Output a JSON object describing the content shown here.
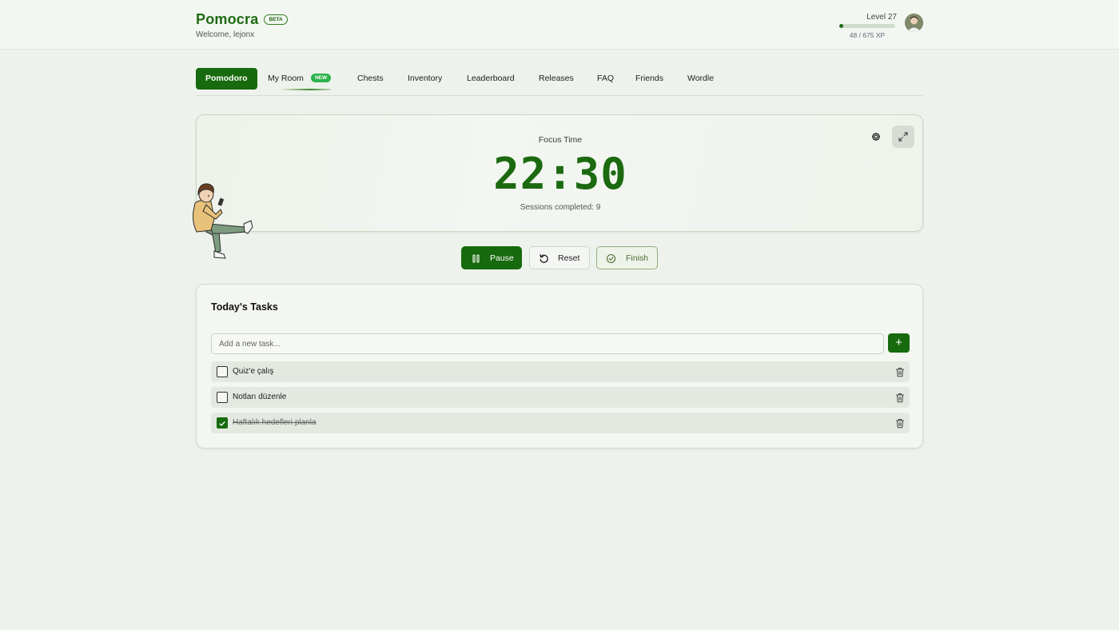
{
  "header": {
    "brand": "Pomocra",
    "beta_badge": "BETA",
    "welcome": "Welcome, lejonx",
    "level": "Level 27",
    "xp_text": "48 / 675 XP",
    "xp_progress": 0.071
  },
  "nav": {
    "tabs": [
      {
        "label": "Pomodoro",
        "active": true
      },
      {
        "label": "My Room",
        "badge": "NEW"
      },
      {
        "label": "Chests"
      },
      {
        "label": "Inventory"
      },
      {
        "label": "Leaderboard"
      },
      {
        "label": "Releases"
      },
      {
        "label": "FAQ"
      },
      {
        "label": "Friends"
      },
      {
        "label": "Wordle"
      }
    ]
  },
  "timer": {
    "mode_label": "Focus Time",
    "time": "22:30",
    "sessions": "Sessions completed: 9"
  },
  "controls": {
    "pause": "Pause",
    "reset": "Reset",
    "finish": "Finish"
  },
  "tasks": {
    "title": "Today's Tasks",
    "input_placeholder": "Add a new task...",
    "add_label": "+",
    "items": [
      {
        "text": "Quiz'e çalış",
        "done": false
      },
      {
        "text": "Notları düzenle",
        "done": false
      },
      {
        "text": "Haftalık hedefleri planla",
        "done": true
      }
    ]
  },
  "colors": {
    "brand": "#1f6b12",
    "accent": "#176a0d",
    "new_badge": "#2cb34a",
    "background": "#eef2ec"
  },
  "icons": [
    "settings-gear-icon",
    "expand-icon",
    "pause-icon",
    "reset-icon",
    "check-circle-icon",
    "trash-icon",
    "check-icon"
  ]
}
